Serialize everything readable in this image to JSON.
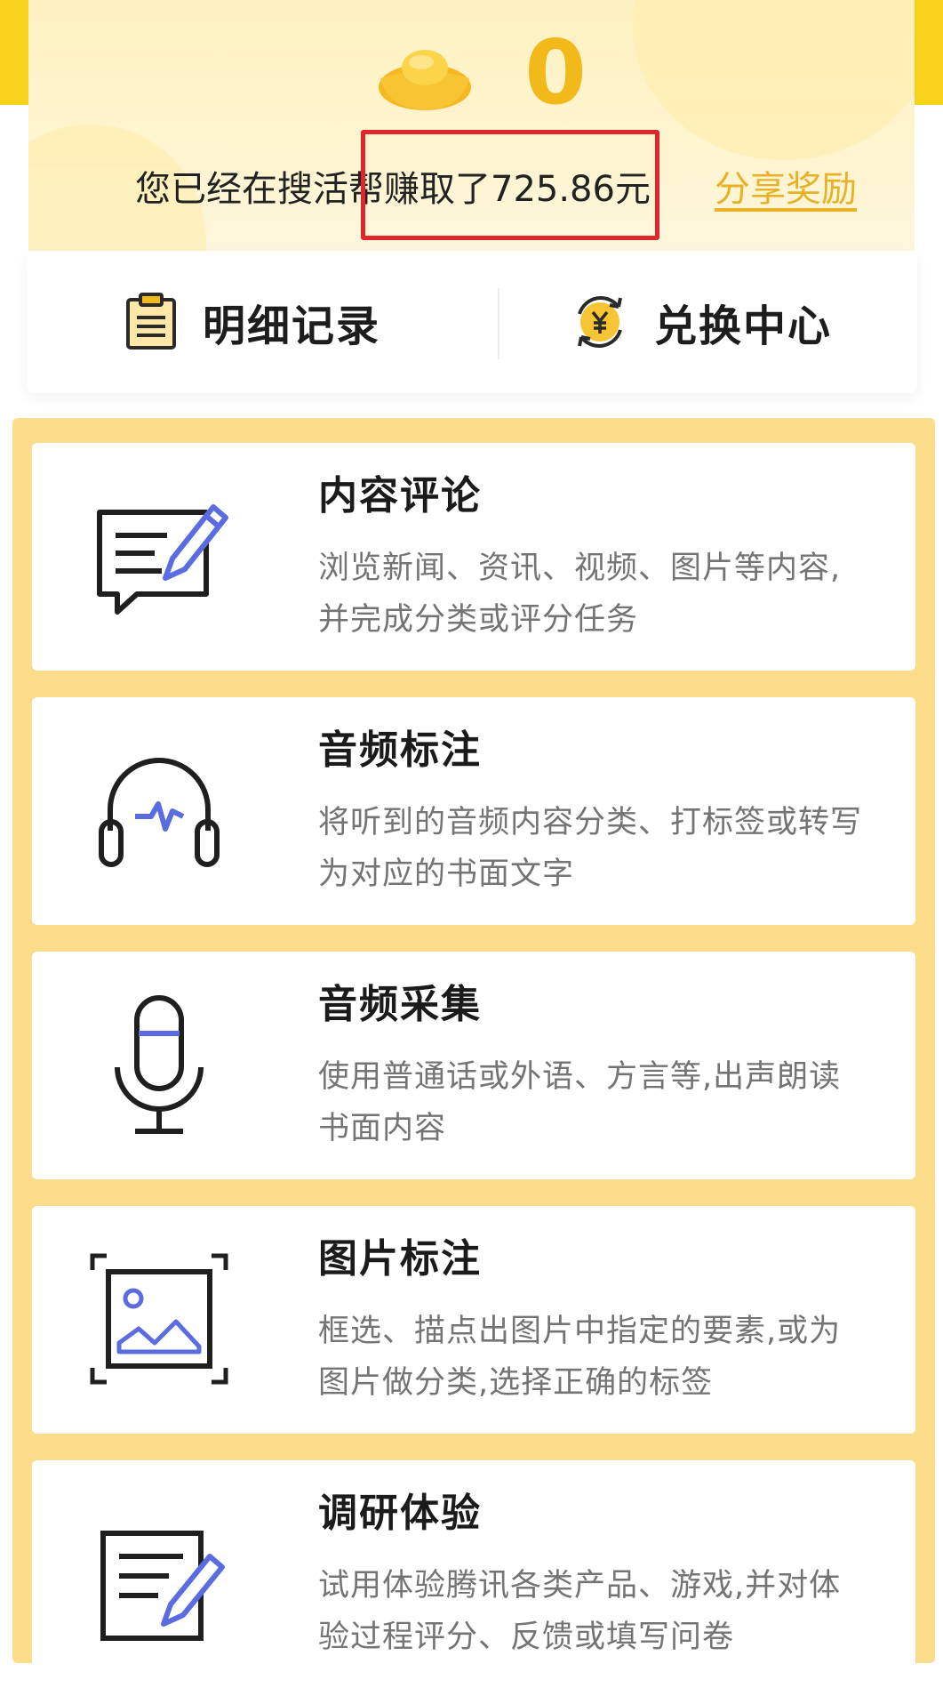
{
  "header": {
    "coin_count": "0",
    "earned_prefix": "您已经在搜活帮",
    "earned_amount": "赚取了725.86元",
    "share_link": "分享奖励"
  },
  "actions": {
    "detail_label": "明细记录",
    "exchange_label": "兑换中心"
  },
  "tasks": [
    {
      "title": "内容评论",
      "desc_line1": "浏览新闻、资讯、视频、图片等内容,",
      "desc_line2": "并完成分类或评分任务",
      "icon": "comment-edit-icon"
    },
    {
      "title": "音频标注",
      "desc_line1": "将听到的音频内容分类、打标签或转写",
      "desc_line2": "为对应的书面文字",
      "icon": "headphones-icon"
    },
    {
      "title": "音频采集",
      "desc_line1": "使用普通话或外语、方言等,出声朗读",
      "desc_line2": "书面内容",
      "icon": "microphone-icon"
    },
    {
      "title": "图片标注",
      "desc_line1": "框选、描点出图片中指定的要素,或为",
      "desc_line2": "图片做分类,选择正确的标签",
      "icon": "image-annotate-icon"
    },
    {
      "title": "调研体验",
      "desc_line1": "试用体验腾讯各类产品、游戏,并对体",
      "desc_line2": "验过程评分、反馈或填写问卷",
      "icon": "survey-edit-icon"
    }
  ],
  "colors": {
    "accent_yellow": "#f1b91a",
    "panel_yellow": "#fbdc8a",
    "icon_blue": "#5b6be0",
    "highlight_red": "#e0262a"
  }
}
